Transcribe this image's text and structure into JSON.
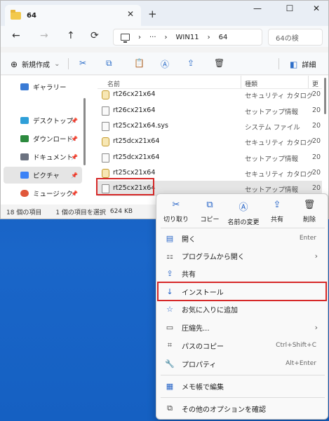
{
  "window": {
    "tab_title": "64",
    "tab_close": "✕",
    "new_tab": "+",
    "minimize": "—",
    "maximize": "☐",
    "close": "✕"
  },
  "address": {
    "back": "←",
    "forward": "→",
    "up": "↑",
    "crumb_sep1": "›",
    "ellipsis": "···",
    "crumb_sep2": "›",
    "crumb1": "WIN11",
    "crumb_sep3": "›",
    "crumb2": "64",
    "search_placeholder": "64の検"
  },
  "toolbar": {
    "new_label": "新規作成",
    "new_caret": "⌄",
    "details_label": "詳細"
  },
  "sidebar": {
    "items": [
      {
        "label": "ギャラリー",
        "color": "#3a7bd5"
      },
      {
        "label": "デスクトップ",
        "color": "#2f9fd8"
      },
      {
        "label": "ダウンロード",
        "color": "#2c8a3e"
      },
      {
        "label": "ドキュメント",
        "color": "#6b7280"
      },
      {
        "label": "ピクチャ",
        "color": "#3b82f6"
      },
      {
        "label": "ミュージック",
        "color": "#e0573a"
      }
    ],
    "pin": "📌"
  },
  "columns": {
    "name": "名前",
    "type": "種類",
    "date": "更"
  },
  "files": [
    {
      "name": "rt26cx21x64",
      "type": "セキュリティ カタログ",
      "date": "20",
      "kind": "cat"
    },
    {
      "name": "rt26cx21x64",
      "type": "セットアップ情報",
      "date": "20",
      "kind": "inf"
    },
    {
      "name": "rt25cx21x64.sys",
      "type": "システム ファイル",
      "date": "20",
      "kind": "inf"
    },
    {
      "name": "rt25dcx21x64",
      "type": "セキュリティ カタログ",
      "date": "20",
      "kind": "cat"
    },
    {
      "name": "rt25dcx21x64",
      "type": "セットアップ情報",
      "date": "20",
      "kind": "inf"
    },
    {
      "name": "rt25cx21x64",
      "type": "セキュリティ カタログ",
      "date": "20",
      "kind": "cat"
    },
    {
      "name": "rt25cx21x64",
      "type": "セットアップ情報",
      "date": "20",
      "kind": "inf"
    }
  ],
  "status": {
    "count": "18 個の項目",
    "selected": "1 個の項目を選択",
    "size": "624 KB"
  },
  "context_menu": {
    "quick": [
      {
        "label": "切り取り",
        "icon": "✂"
      },
      {
        "label": "コピー",
        "icon": "⧉"
      },
      {
        "label": "名前の変更",
        "icon": "Ⓐ"
      },
      {
        "label": "共有",
        "icon": "⇪"
      },
      {
        "label": "削除",
        "icon": "🗑"
      }
    ],
    "items": [
      {
        "label": "開く",
        "shortcut": "Enter"
      },
      {
        "label": "プログラムから開く",
        "arrow": "›"
      },
      {
        "label": "共有"
      },
      {
        "label": "インストール"
      },
      {
        "label": "お気に入りに追加"
      },
      {
        "label": "圧縮先...",
        "arrow": "›"
      },
      {
        "label": "パスのコピー",
        "shortcut": "Ctrl+Shift+C"
      },
      {
        "label": "プロパティ",
        "shortcut": "Alt+Enter"
      },
      {
        "label": "メモ帳で編集"
      },
      {
        "label": "その他のオプションを確認"
      }
    ]
  },
  "colors": {
    "highlight": "#d62828",
    "accent": "#2563c7"
  }
}
